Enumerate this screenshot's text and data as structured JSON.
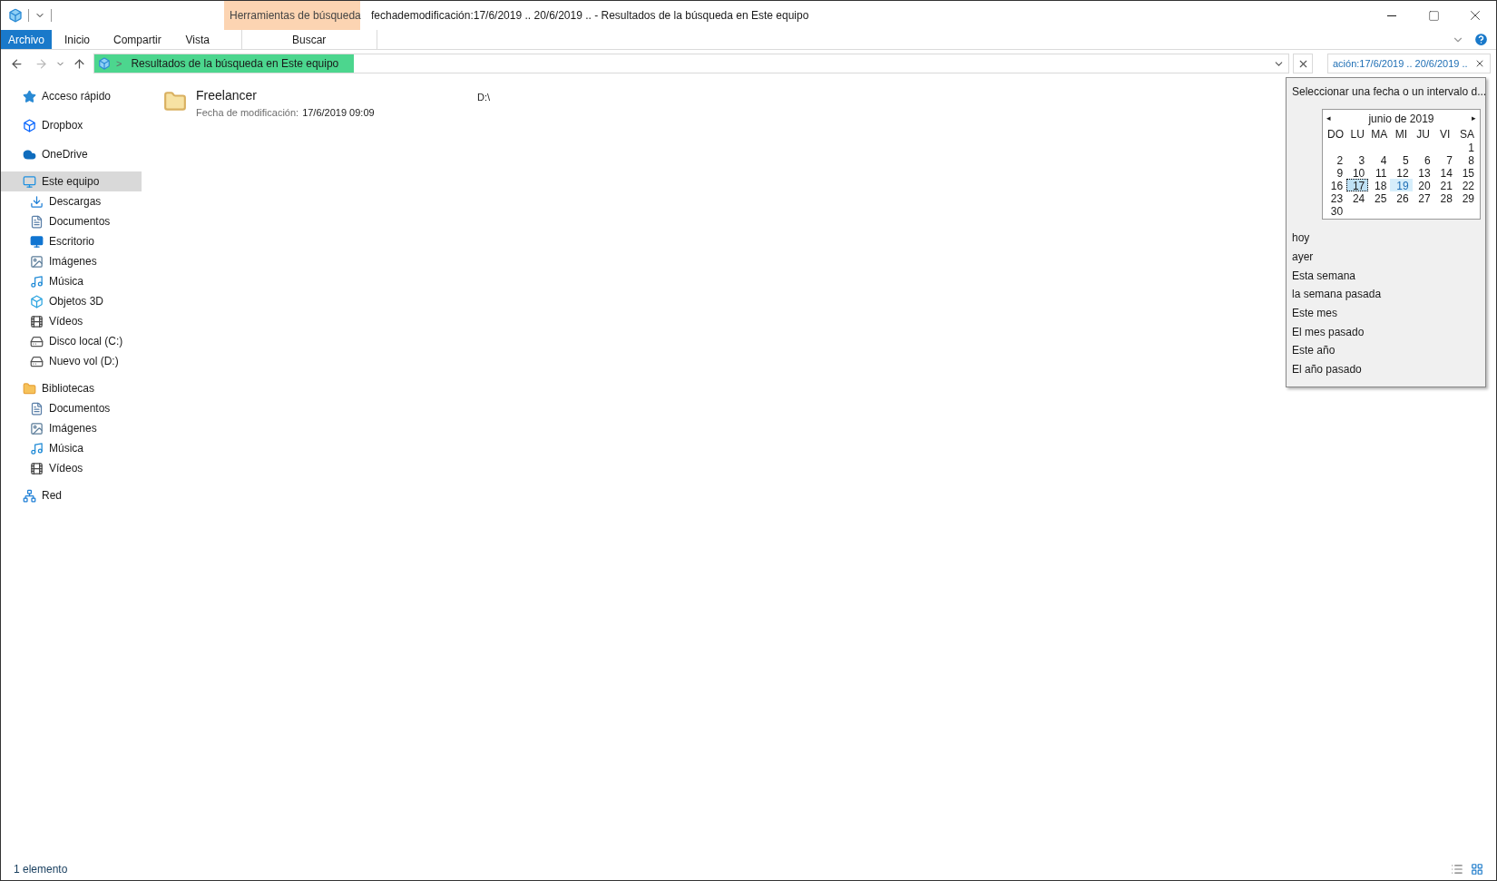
{
  "window": {
    "title": "fechademodificación:17/6/2019 .. 20/6/2019 .. - Resultados de la búsqueda en Este equipo"
  },
  "context_tab": {
    "group": "Herramientas de búsqueda",
    "label": "Buscar"
  },
  "ribbon_tabs": [
    {
      "label": "Archivo",
      "kind": "file"
    },
    {
      "label": "Inicio",
      "kind": "tab",
      "selected": false
    },
    {
      "label": "Compartir",
      "kind": "tab",
      "selected": false
    },
    {
      "label": "Vista",
      "kind": "tab",
      "selected": false
    }
  ],
  "address_bar": {
    "separator": ">",
    "path": "Resultados de la búsqueda en Este equipo"
  },
  "search_box": {
    "value": "ación:17/6/2019 .. 20/6/2019 .."
  },
  "sidebar": {
    "items": [
      {
        "label": "Acceso rápido",
        "selected": false
      },
      {
        "label": "Dropbox",
        "selected": false
      },
      {
        "label": "OneDrive",
        "selected": false
      },
      {
        "label": "Este equipo",
        "selected": true,
        "children": [
          {
            "label": "Descargas",
            "selected": false
          },
          {
            "label": "Documentos",
            "selected": false
          },
          {
            "label": "Escritorio",
            "selected": false
          },
          {
            "label": "Imágenes",
            "selected": false
          },
          {
            "label": "Música",
            "selected": false
          },
          {
            "label": "Objetos 3D",
            "selected": false
          },
          {
            "label": "Vídeos",
            "selected": false
          },
          {
            "label": "Disco local (C:)",
            "selected": false
          },
          {
            "label": "Nuevo vol (D:)",
            "selected": false
          }
        ]
      },
      {
        "label": "Bibliotecas",
        "selected": false,
        "children": [
          {
            "label": "Documentos",
            "selected": false
          },
          {
            "label": "Imágenes",
            "selected": false
          },
          {
            "label": "Música",
            "selected": false
          },
          {
            "label": "Vídeos",
            "selected": false
          }
        ]
      },
      {
        "label": "Red",
        "selected": false
      }
    ]
  },
  "results": [
    {
      "name": "Freelancer",
      "meta_label": "Fecha de modificación:",
      "meta_value": "17/6/2019 09:09",
      "location": "D:\\"
    }
  ],
  "date_popup": {
    "title": "Seleccionar una fecha o un intervalo d...",
    "month": "junio de 2019",
    "prev": "◂",
    "next": "▸",
    "weekdays": [
      "DO",
      "LU",
      "MA",
      "MI",
      "JU",
      "VI",
      "SA"
    ],
    "weeks": [
      [
        {
          "label": "1",
          "selected": false
        }
      ],
      [
        {
          "label": "2",
          "selected": false
        },
        {
          "label": "3",
          "selected": false
        },
        {
          "label": "4",
          "selected": false
        },
        {
          "label": "5",
          "selected": false
        },
        {
          "label": "6",
          "selected": false
        },
        {
          "label": "7",
          "selected": false
        },
        {
          "label": "8",
          "selected": false
        }
      ],
      [
        {
          "label": "9",
          "selected": false
        },
        {
          "label": "10",
          "selected": false
        },
        {
          "label": "11",
          "selected": false
        },
        {
          "label": "12",
          "selected": false
        },
        {
          "label": "13",
          "selected": false
        },
        {
          "label": "14",
          "selected": false
        },
        {
          "label": "15",
          "selected": false
        }
      ],
      [
        {
          "label": "16",
          "selected": false
        },
        {
          "label": "17",
          "selected": true
        },
        {
          "label": "18",
          "selected": false
        },
        {
          "label": "19",
          "selected": false,
          "hot": true
        },
        {
          "label": "20",
          "selected": false
        },
        {
          "label": "21",
          "selected": false
        },
        {
          "label": "22",
          "selected": false
        }
      ],
      [
        {
          "label": "23",
          "selected": false
        },
        {
          "label": "24",
          "selected": false
        },
        {
          "label": "25",
          "selected": false
        },
        {
          "label": "26",
          "selected": false
        },
        {
          "label": "27",
          "selected": false
        },
        {
          "label": "28",
          "selected": false
        },
        {
          "label": "29",
          "selected": false
        }
      ],
      [
        {
          "label": "30",
          "selected": false
        }
      ]
    ],
    "presets": [
      "hoy",
      "ayer",
      "Esta semana",
      "la semana pasada",
      "Este mes",
      "El mes pasado",
      "Este año",
      "El año pasado"
    ]
  },
  "status_bar": {
    "count": "1 elemento"
  }
}
